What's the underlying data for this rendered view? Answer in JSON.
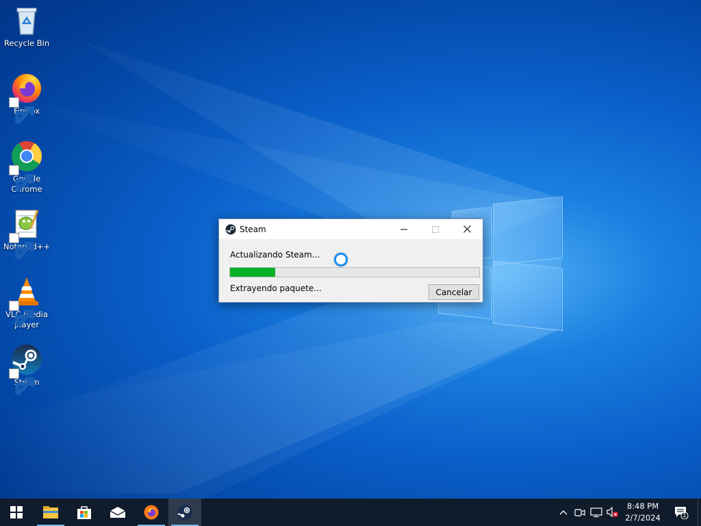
{
  "desktop": {
    "icons": [
      {
        "label": "Recycle Bin",
        "icon": "recycle-bin-icon"
      },
      {
        "label": "Firefox",
        "icon": "firefox-icon"
      },
      {
        "label": "Google Chrome",
        "icon": "chrome-icon"
      },
      {
        "label": "Notepad++",
        "icon": "notepadpp-icon"
      },
      {
        "label": "VLC media player",
        "icon": "vlc-icon"
      },
      {
        "label": "Steam",
        "icon": "steam-icon"
      }
    ]
  },
  "dialog": {
    "title": "Steam",
    "status_top": "Actualizando Steam...",
    "status_bottom": "Extrayendo paquete...",
    "cancel_label": "Cancelar",
    "progress": 0.18,
    "colors": {
      "progress_fill": "#06b025"
    }
  },
  "taskbar": {
    "items": [
      "start-icon",
      "file-explorer-icon",
      "microsoft-store-icon",
      "mail-icon",
      "firefox-icon",
      "steam-icon"
    ],
    "active_item": "steam-icon",
    "clock": {
      "time": "8:48 PM",
      "date": "2/7/2024"
    },
    "notification_count": "1"
  }
}
